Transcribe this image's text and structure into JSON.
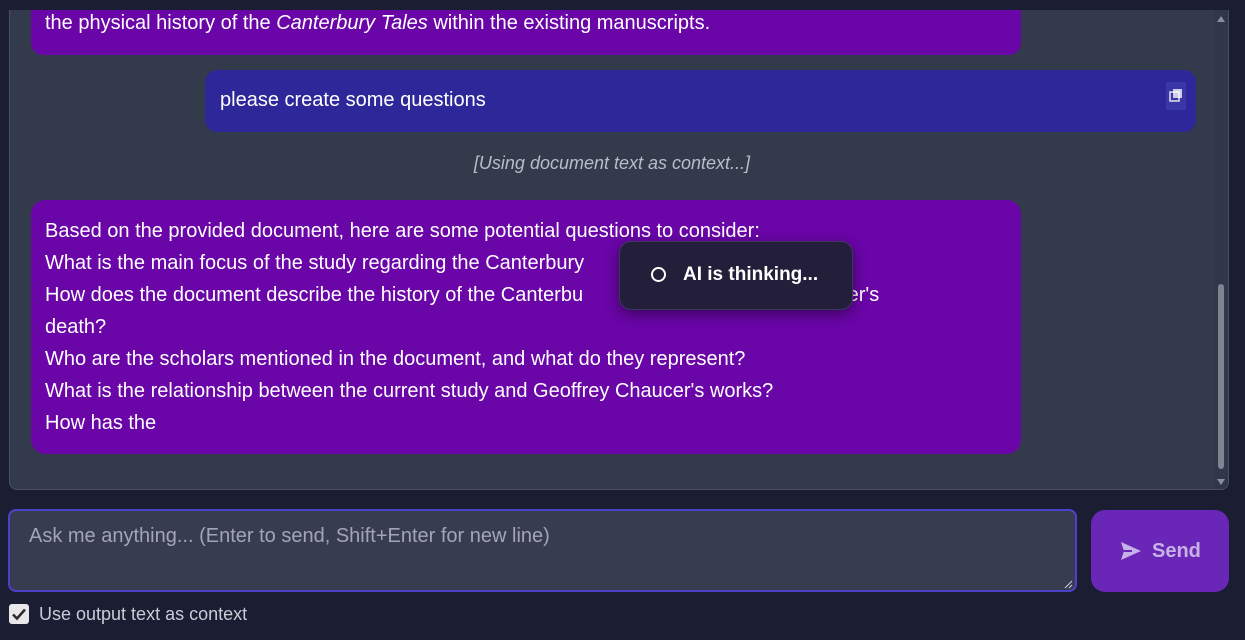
{
  "chat": {
    "messages": [
      {
        "role": "assistant",
        "partial_line_before": "the physical history of the ",
        "partial_line_italic": "Canterbury Tales",
        "partial_line_after": " within the existing manuscripts."
      },
      {
        "role": "user",
        "text": "please create some questions",
        "copy_icon": "copy-icon"
      },
      {
        "role": "system",
        "text": "[Using document text as context...]"
      },
      {
        "role": "assistant",
        "lines": [
          "Based on the provided document, here are some potential questions to consider:",
          "What is the main focus of the study regarding the Canterbury",
          "How does the document describe the history of the Canterbu                                   r Chaucer's",
          "death?",
          "Who are the scholars mentioned in the document, and what do they represent?",
          "What is the relationship between the current study and Geoffrey Chaucer's works?",
          "How has the"
        ]
      }
    ],
    "thinking_indicator": {
      "text": "AI is thinking...",
      "icon": "spinner-icon"
    }
  },
  "composer": {
    "placeholder": "Ask me anything... (Enter to send, Shift+Enter for new line)",
    "value": "",
    "send_label": "Send",
    "send_icon": "send-icon",
    "context_option": {
      "label": "Use output text as context",
      "checked": true
    }
  },
  "colors": {
    "background": "#1b1d33",
    "panel": "#333a4b",
    "assistant_bubble": "#6a05a8",
    "user_bubble": "#2d2799",
    "send_button": "#6a26b7",
    "input_border": "#4c42c9"
  }
}
